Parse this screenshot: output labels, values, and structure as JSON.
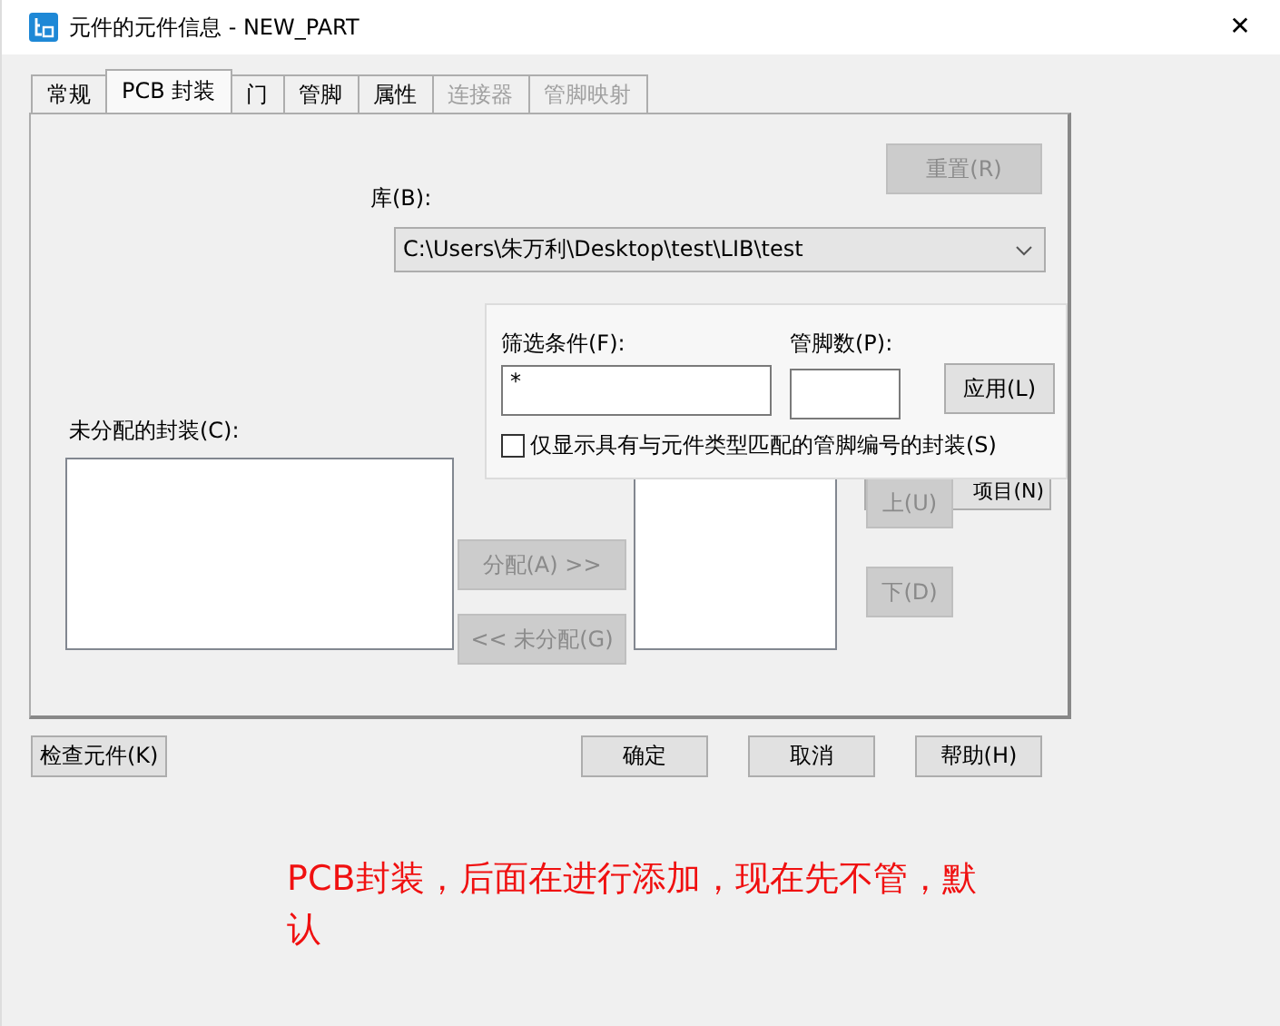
{
  "window": {
    "title": "元件的元件信息 - NEW_PART",
    "close": "✕"
  },
  "tabs": [
    {
      "label": "常规",
      "selected": false,
      "disabled": false
    },
    {
      "label": "PCB 封装",
      "selected": true,
      "disabled": false
    },
    {
      "label": "门",
      "selected": false,
      "disabled": false
    },
    {
      "label": "管脚",
      "selected": false,
      "disabled": false
    },
    {
      "label": "属性",
      "selected": false,
      "disabled": false
    },
    {
      "label": "连接器",
      "selected": false,
      "disabled": true
    },
    {
      "label": "管脚映射",
      "selected": false,
      "disabled": true
    }
  ],
  "reset_button": {
    "label": "重置(R)",
    "disabled": true
  },
  "library": {
    "label": "库(B):",
    "value": "C:\\Users\\朱万利\\Desktop\\test\\LIB\\test"
  },
  "filter_popup": {
    "filter_label": "筛选条件(F):",
    "filter_value": "*",
    "pins_label": "管脚数(P):",
    "apply_button": "应用(L)",
    "checkbox": {
      "label": "仅显示具有与元件类型匹配的管脚编号的封装(S)",
      "checked": false
    }
  },
  "unassigned": {
    "label": "未分配的封装(C):"
  },
  "assign_buttons": [
    {
      "label": "分配(A) >>",
      "disabled": true
    },
    {
      "label": "<< 未分配(G)",
      "disabled": true
    }
  ],
  "item_button": {
    "label": "项目(N)",
    "disabled": false
  },
  "move_buttons": [
    {
      "label": "上(U)",
      "disabled": true
    },
    {
      "label": "下(D)",
      "disabled": true
    }
  ],
  "footer_buttons": [
    {
      "label": "检查元件(K)",
      "kind": "left"
    },
    {
      "label": "确定",
      "kind": "right"
    },
    {
      "label": "取消",
      "kind": "right"
    },
    {
      "label": "帮助(H)",
      "kind": "right"
    }
  ],
  "annotation": "PCB封装，后面在进行添加，现在先不管，默认"
}
